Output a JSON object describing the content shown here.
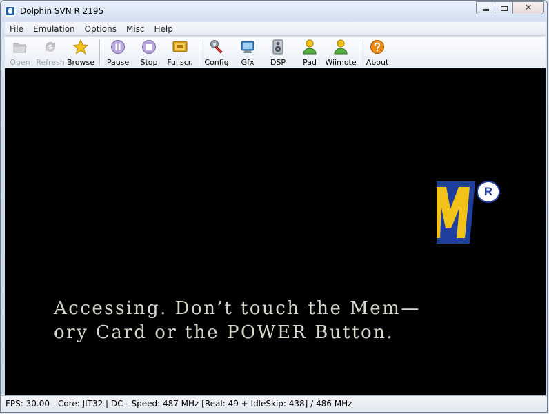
{
  "window": {
    "title": "Dolphin SVN R 2195",
    "close_glyph": "✕"
  },
  "menu": [
    "File",
    "Emulation",
    "Options",
    "Misc",
    "Help"
  ],
  "toolbar": {
    "open": "Open",
    "refresh": "Refresh",
    "browse": "Browse",
    "pause": "Pause",
    "stop": "Stop",
    "fullscreen": "Fullscr.",
    "config": "Config",
    "gfx": "Gfx",
    "dsp": "DSP",
    "pad": "Pad",
    "wiimote": "Wiimote",
    "about": "About"
  },
  "icons": {
    "open": "folder-icon",
    "refresh": "refresh-icon",
    "browse": "star-icon",
    "pause": "pause-icon",
    "stop": "stop-icon",
    "fullscreen": "fullscreen-icon",
    "config": "wrench-icon",
    "gfx": "monitor-icon",
    "dsp": "speaker-icon",
    "pad": "person-icon",
    "wiimote": "person-icon",
    "about": "question-icon"
  },
  "game_screen": {
    "line1": "Accessing. Don’t touch the Mem—",
    "line2": "ory Card or the POWER Button.",
    "registered_mark": "R"
  },
  "status": {
    "text": "FPS:  30.00 - Core: JIT32 | DC - Speed: 487 MHz [Real: 49 + IdleSkip: 438] / 486 MHz"
  },
  "colors": {
    "screen_bg": "#000000",
    "game_text": "#d9d6cc",
    "logo_yellow": "#f2c219",
    "logo_blue": "#1f3f9f"
  }
}
